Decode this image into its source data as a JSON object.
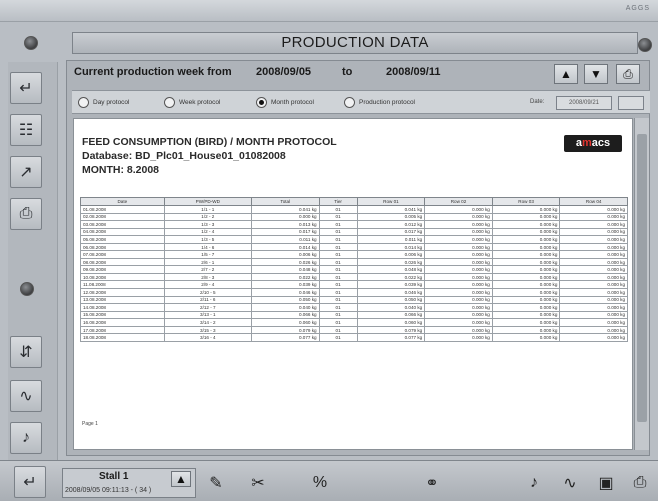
{
  "header": {
    "brand": "AGGS",
    "title": "PRODUCTION DATA"
  },
  "week": {
    "label": "Current production week from",
    "from": "2008/09/05",
    "to_label": "to",
    "to": "2008/09/11"
  },
  "protocols": [
    {
      "label": "Day protocol",
      "selected": false
    },
    {
      "label": "Week protocol",
      "selected": false
    },
    {
      "label": "Month protocol",
      "selected": true
    },
    {
      "label": "Production protocol",
      "selected": false
    }
  ],
  "date": {
    "label": "Date:",
    "value": "2008/09/21"
  },
  "report": {
    "title": "FEED CONSUMPTION (BIRD) / MONTH PROTOCOL",
    "database": "Database: BD_Plc01_House01_01082008",
    "month": "MONTH: 8.2008",
    "logo": {
      "pre": "a",
      "mid": "m",
      "post": "acs"
    },
    "columns": [
      "Date",
      "PW/PD-WD",
      "Total",
      "Tier",
      "Row 01",
      "Row 02",
      "Row 03",
      "Row 04"
    ],
    "rows": [
      [
        "01.08.2008",
        "1/1 - 1",
        "0.041 kg",
        "01",
        "0.041 kg",
        "0.000 kg",
        "0.000 kg",
        "0.000 kg"
      ],
      [
        "02.08.2008",
        "1/2 - 2",
        "0.000 kg",
        "01",
        "0.005 kg",
        "0.000 kg",
        "0.000 kg",
        "0.000 kg"
      ],
      [
        "03.08.2008",
        "1/3 - 3",
        "0.013 kg",
        "01",
        "0.012 kg",
        "0.000 kg",
        "0.000 kg",
        "0.000 kg"
      ],
      [
        "04.08.2008",
        "1/2 - 4",
        "0.017 kg",
        "01",
        "0.017 kg",
        "0.000 kg",
        "0.000 kg",
        "0.000 kg"
      ],
      [
        "05.08.2008",
        "1/3 - 5",
        "0.011 kg",
        "01",
        "0.011 kg",
        "0.000 kg",
        "0.000 kg",
        "0.000 kg"
      ],
      [
        "06.08.2008",
        "1/4 - 6",
        "0.014 kg",
        "01",
        "0.014 kg",
        "0.000 kg",
        "0.000 kg",
        "0.000 kg"
      ],
      [
        "07.08.2008",
        "1/5 - 7",
        "0.006 kg",
        "01",
        "0.006 kg",
        "0.000 kg",
        "0.000 kg",
        "0.000 kg"
      ],
      [
        "08.08.2008",
        "2/6 - 1",
        "0.026 kg",
        "01",
        "0.026 kg",
        "0.000 kg",
        "0.000 kg",
        "0.000 kg"
      ],
      [
        "09.08.2008",
        "2/7 - 2",
        "0.048 kg",
        "01",
        "0.048 kg",
        "0.000 kg",
        "0.000 kg",
        "0.000 kg"
      ],
      [
        "10.08.2008",
        "2/8 - 3",
        "0.022 kg",
        "01",
        "0.022 kg",
        "0.000 kg",
        "0.000 kg",
        "0.000 kg"
      ],
      [
        "11.08.2008",
        "2/9 - 4",
        "0.039 kg",
        "01",
        "0.039 kg",
        "0.000 kg",
        "0.000 kg",
        "0.000 kg"
      ],
      [
        "12.08.2008",
        "2/10 - 5",
        "0.046 kg",
        "01",
        "0.046 kg",
        "0.000 kg",
        "0.000 kg",
        "0.000 kg"
      ],
      [
        "13.08.2008",
        "2/11 - 6",
        "0.050 kg",
        "01",
        "0.050 kg",
        "0.000 kg",
        "0.000 kg",
        "0.000 kg"
      ],
      [
        "14.08.2008",
        "2/12 - 7",
        "0.040 kg",
        "01",
        "0.040 kg",
        "0.000 kg",
        "0.000 kg",
        "0.000 kg"
      ],
      [
        "15.08.2008",
        "3/13 - 1",
        "0.066 kg",
        "01",
        "0.066 kg",
        "0.000 kg",
        "0.000 kg",
        "0.000 kg"
      ],
      [
        "16.08.2008",
        "3/14 - 2",
        "0.060 kg",
        "01",
        "0.060 kg",
        "0.000 kg",
        "0.000 kg",
        "0.000 kg"
      ],
      [
        "17.08.2008",
        "3/15 - 3",
        "0.079 kg",
        "01",
        "0.079 kg",
        "0.000 kg",
        "0.000 kg",
        "0.000 kg"
      ],
      [
        "18.08.2008",
        "3/16 - 4",
        "0.077 kg",
        "01",
        "0.077 kg",
        "0.000 kg",
        "0.000 kg",
        "0.000 kg"
      ]
    ],
    "page": "Page 1"
  },
  "footer": {
    "stall": "Stall 1",
    "timestamp": "2008/09/05 09:11:13 - ( 34 )"
  },
  "icons": {
    "left": [
      "enter-icon",
      "document-icon",
      "chart-icon",
      "printer-icon",
      "knob-icon",
      "adjust-icon",
      "graph-icon",
      "speaker-icon",
      "enter-icon"
    ],
    "bottom": [
      "pen-icon",
      "scissors-icon",
      "ratio-icon",
      "chain-icon",
      "speaker-icon",
      "graph-icon",
      "camera-icon",
      "printer-icon"
    ]
  },
  "colors": {
    "background": "#b9bec4",
    "panel": "#aeb3b9",
    "report": "#ffffff",
    "logo_accent": "#e3342f"
  }
}
